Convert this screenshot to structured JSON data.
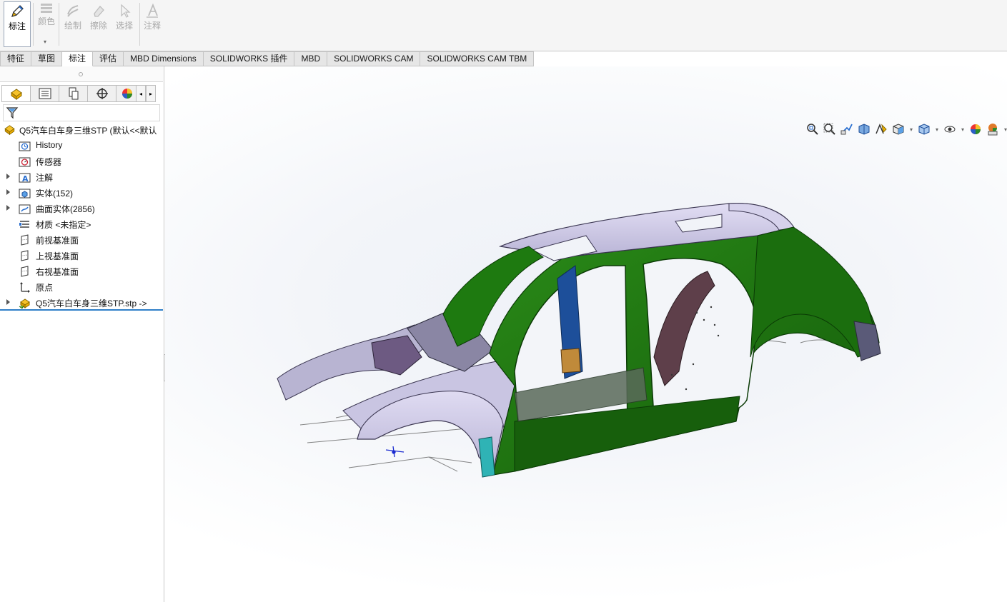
{
  "ribbon": {
    "buttons": [
      {
        "label": "标注",
        "icon": "annotate-pen-icon",
        "active": true
      },
      {
        "label": "颜色",
        "icon": "color-lines-icon",
        "active": false
      },
      {
        "label": "绘制",
        "icon": "draw-icon",
        "active": false
      },
      {
        "label": "擦除",
        "icon": "eraser-icon",
        "active": false
      },
      {
        "label": "选择",
        "icon": "select-arrow-icon",
        "active": false
      },
      {
        "label": "注释",
        "icon": "note-icon",
        "active": false
      }
    ]
  },
  "tabs": [
    "特征",
    "草图",
    "标注",
    "评估",
    "MBD Dimensions",
    "SOLIDWORKS 插件",
    "MBD",
    "SOLIDWORKS CAM",
    "SOLIDWORKS CAM TBM"
  ],
  "active_tab": "标注",
  "feature_manager": {
    "panel_tabs": [
      "feature-manager-tab-icon",
      "property-manager-tab-icon",
      "configuration-manager-tab-icon",
      "dimxpert-tab-icon",
      "display-manager-tab-icon"
    ],
    "root": "Q5汽车白车身三维STP  (默认<<默认",
    "items": [
      {
        "label": "History",
        "icon": "history-folder-icon",
        "expandable": false
      },
      {
        "label": "传感器",
        "icon": "sensor-folder-icon",
        "expandable": false
      },
      {
        "label": "注解",
        "icon": "annotation-folder-icon",
        "expandable": true
      },
      {
        "label": "实体(152)",
        "icon": "solid-bodies-folder-icon",
        "expandable": true
      },
      {
        "label": "曲面实体(2856)",
        "icon": "surface-bodies-folder-icon",
        "expandable": true
      },
      {
        "label": "材质 <未指定>",
        "icon": "material-icon",
        "expandable": false
      },
      {
        "label": "前视基准面",
        "icon": "plane-icon",
        "expandable": false
      },
      {
        "label": "上视基准面",
        "icon": "plane-icon",
        "expandable": false
      },
      {
        "label": "右视基准面",
        "icon": "plane-icon",
        "expandable": false
      },
      {
        "label": "原点",
        "icon": "origin-icon",
        "expandable": false
      },
      {
        "label": "Q5汽车白车身三维STP.stp ->",
        "icon": "imported-part-icon",
        "expandable": true
      }
    ]
  },
  "heads_up_toolbar": [
    "zoom-to-fit-icon",
    "zoom-to-area-icon",
    "previous-view-icon",
    "section-view-icon",
    "dynamic-annotation-icon",
    "view-orientation-icon",
    "display-style-icon",
    "hide-show-items-icon",
    "edit-appearance-icon",
    "apply-scene-icon",
    "view-settings-icon"
  ],
  "colors": {
    "body_green": "#1f7a12",
    "body_dark_green": "#0f4a08",
    "roof_lavender": "#cfcbe8",
    "fender_gray": "#b9b5d3",
    "inner_purple": "#6d5a82",
    "pillar_blue": "#1d4f9a",
    "teal_bracket": "#2fb3b5"
  }
}
